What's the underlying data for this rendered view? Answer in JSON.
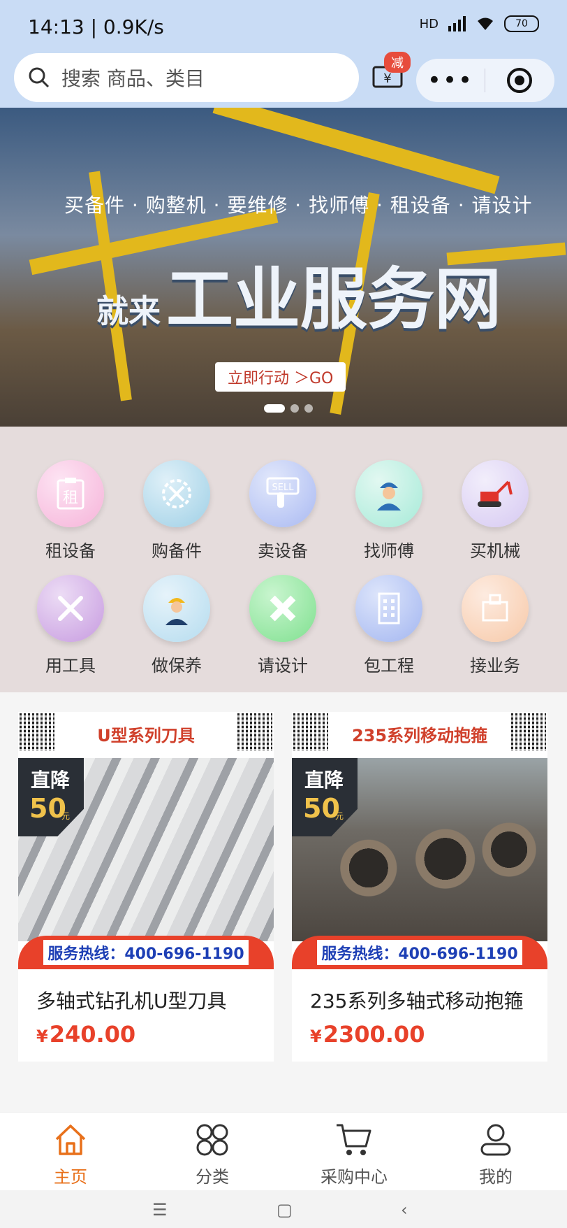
{
  "status_bar": {
    "time": "14:13 | 0.9K/s",
    "network": "HD",
    "battery": "70"
  },
  "search": {
    "placeholder": "搜索 商品、类目"
  },
  "coupon_badge": "减",
  "banner": {
    "slogan": "买备件 · 购整机 · 要维修 · 找师傅 · 租设备 · 请设计",
    "headline_prefix": "就来",
    "headline": "工业服务网",
    "cta": "立即行动 ＞GO",
    "slide_count": 3,
    "active_slide": 0
  },
  "categories": [
    {
      "label": "租设备",
      "icon": "clipboard-rent-icon",
      "color": "#f6b3d9"
    },
    {
      "label": "购备件",
      "icon": "wrench-gear-icon",
      "color": "#9fd0e6"
    },
    {
      "label": "卖设备",
      "icon": "sell-hand-icon",
      "color": "#a9b9f2"
    },
    {
      "label": "找师傅",
      "icon": "worker-icon",
      "color": "#a6ead8"
    },
    {
      "label": "买机械",
      "icon": "excavator-icon",
      "color": "#d6c9f2"
    },
    {
      "label": "用工具",
      "icon": "tools-icon",
      "color": "#c79be0"
    },
    {
      "label": "做保养",
      "icon": "maintenance-worker-icon",
      "color": "#b5dcef"
    },
    {
      "label": "请设计",
      "icon": "pencil-ruler-icon",
      "color": "#7fe08f"
    },
    {
      "label": "包工程",
      "icon": "building-icon",
      "color": "#a3b6f0"
    },
    {
      "label": "接业务",
      "icon": "briefcase-icon",
      "color": "#f7c9a8"
    }
  ],
  "products": [
    {
      "banner_title": "U型系列刀具",
      "promo_line1": "直降",
      "promo_amount": "50",
      "promo_unit": "元",
      "hotline": "服务热线：400-696-1190",
      "name": "多轴式钻孔机U型刀具",
      "currency": "¥",
      "price": "240.00"
    },
    {
      "banner_title": "235系列移动抱箍",
      "promo_line1": "直降",
      "promo_amount": "50",
      "promo_unit": "元",
      "hotline": "服务热线：400-696-1190",
      "name": "235系列多轴式移动抱箍",
      "currency": "¥",
      "price": "2300.00"
    }
  ],
  "tabs": [
    {
      "label": "主页",
      "icon": "home-icon",
      "active": true
    },
    {
      "label": "分类",
      "icon": "category-grid-icon",
      "active": false
    },
    {
      "label": "采购中心",
      "icon": "cart-icon",
      "active": false
    },
    {
      "label": "我的",
      "icon": "user-icon",
      "active": false
    }
  ],
  "colors": {
    "accent": "#e8701a",
    "price": "#e8412a",
    "header_bg": "#c9dcf5",
    "grid_bg": "#e5dcdc"
  }
}
